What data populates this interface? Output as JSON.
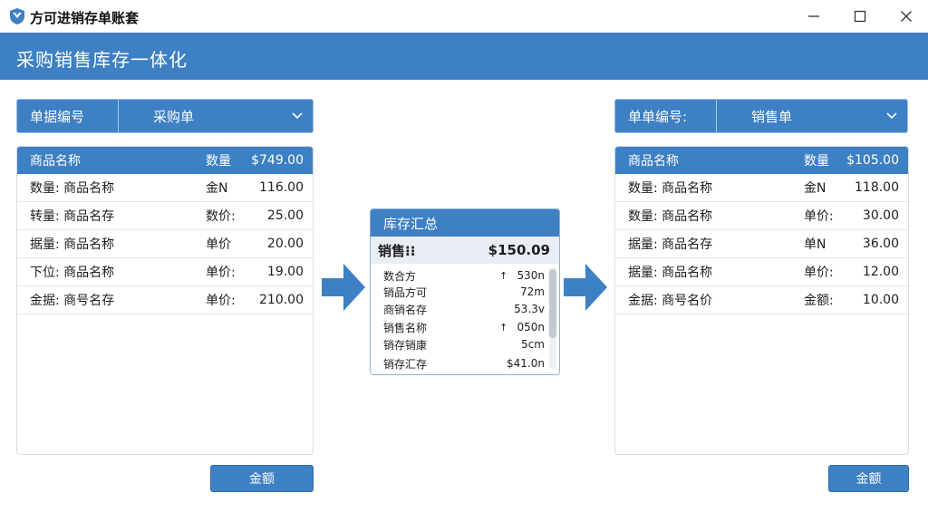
{
  "window": {
    "title": "方可进销存单账套",
    "accent": "#3d80c4"
  },
  "header": {
    "title": "采购销售库存一体化"
  },
  "left": {
    "selector": {
      "label": "单据编号",
      "value": "采购单"
    },
    "columns": [
      "商品名称",
      "数量",
      "$749.00"
    ],
    "rows": [
      [
        "数量: 商品名称",
        "金N",
        "116.00"
      ],
      [
        "转量: 商品名存",
        "数价:",
        "25.00"
      ],
      [
        "据量: 商品名称",
        "单价",
        "20.00"
      ],
      [
        "下位: 商品名称",
        "单价:",
        "19.00"
      ],
      [
        "金据: 商号名存",
        "单价:",
        "210.00"
      ]
    ],
    "button": "金额"
  },
  "summary": {
    "title": "库存汇总",
    "total_label": "销售⁝⁝",
    "total_value": "$150.09",
    "rows": [
      {
        "name": "数合方",
        "trend": "↑",
        "value": "530n"
      },
      {
        "name": "销品方可",
        "trend": "",
        "value": "72m"
      },
      {
        "name": "商销名存",
        "trend": "",
        "value": "53.3v"
      },
      {
        "name": "销售名称",
        "trend": "↑",
        "value": "050n"
      },
      {
        "name": "销存销康",
        "trend": "",
        "value": "5cm"
      },
      {
        "name": "销存汇存",
        "trend": "",
        "value": "$41.0n"
      }
    ]
  },
  "right": {
    "selector": {
      "label": "单单编号:",
      "value": "销售单"
    },
    "columns": [
      "商品名称",
      "数量",
      "$105.00"
    ],
    "rows": [
      [
        "数量: 商品名称",
        "金N",
        "118.00"
      ],
      [
        "数量: 商品名称",
        "单价:",
        "30.00"
      ],
      [
        "据量: 商品名存",
        "单N",
        "36.00"
      ],
      [
        "据量: 商品名称",
        "单价:",
        "12.00"
      ],
      [
        "金据: 商号名价",
        "金额:",
        "10.00"
      ]
    ],
    "button": "金额"
  },
  "icons": {
    "logo": "shield-logo-icon",
    "minimize": "minimize-icon",
    "maximize": "maximize-icon",
    "close": "close-icon",
    "chevron": "chevron-down-icon",
    "arrow": "arrow-right-icon"
  }
}
